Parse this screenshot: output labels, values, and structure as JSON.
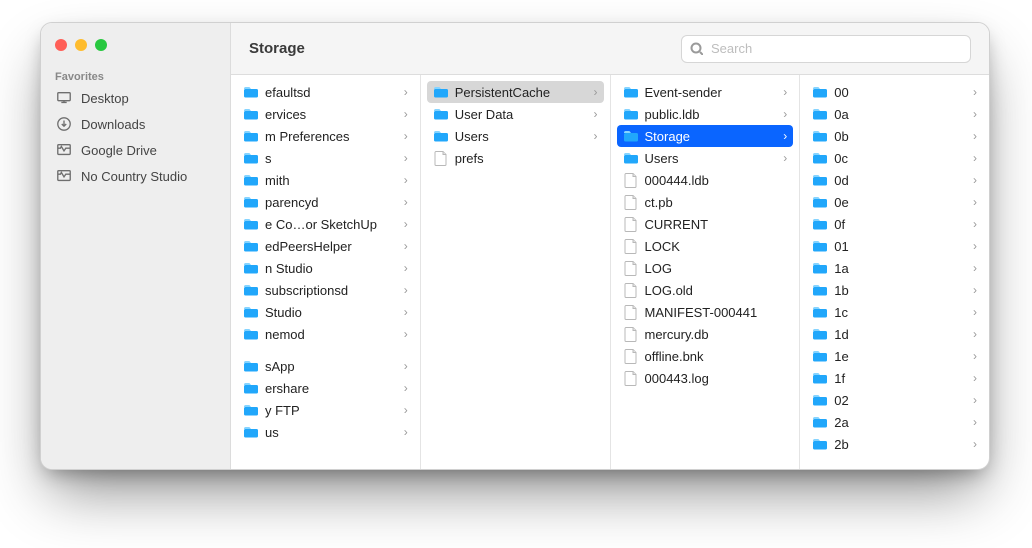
{
  "window": {
    "title": "Storage",
    "search_placeholder": "Search"
  },
  "sidebar": {
    "section_label": "Favorites",
    "items": [
      {
        "icon": "desktop",
        "label": "Desktop"
      },
      {
        "icon": "download",
        "label": "Downloads"
      },
      {
        "icon": "drive",
        "label": "Google Drive"
      },
      {
        "icon": "drive",
        "label": "No Country Studio"
      }
    ]
  },
  "columns": [
    {
      "items": [
        {
          "type": "folder",
          "label": "efaultsd"
        },
        {
          "type": "folder",
          "label": "ervices"
        },
        {
          "type": "folder",
          "label": "m Preferences"
        },
        {
          "type": "folder",
          "label": "s"
        },
        {
          "type": "folder",
          "label": "mith"
        },
        {
          "type": "folder",
          "label": "parencyd"
        },
        {
          "type": "folder",
          "label": "e Co…or SketchUp"
        },
        {
          "type": "folder",
          "label": "edPeersHelper"
        },
        {
          "type": "folder",
          "label": "n Studio"
        },
        {
          "type": "folder",
          "label": "subscriptionsd"
        },
        {
          "type": "folder",
          "label": "Studio"
        },
        {
          "type": "folder",
          "label": "nemod"
        },
        {
          "type": "gap"
        },
        {
          "type": "folder",
          "label": "sApp"
        },
        {
          "type": "folder",
          "label": "ershare"
        },
        {
          "type": "folder",
          "label": "y FTP"
        },
        {
          "type": "folder",
          "label": "us"
        }
      ]
    },
    {
      "items": [
        {
          "type": "folder",
          "label": "PersistentCache",
          "state": "path"
        },
        {
          "type": "folder",
          "label": "User Data"
        },
        {
          "type": "folder",
          "label": "Users"
        },
        {
          "type": "file",
          "label": "prefs"
        }
      ]
    },
    {
      "items": [
        {
          "type": "folder",
          "label": "Event-sender"
        },
        {
          "type": "folder",
          "label": "public.ldb"
        },
        {
          "type": "folder",
          "label": "Storage",
          "state": "selected"
        },
        {
          "type": "folder",
          "label": "Users"
        },
        {
          "type": "file",
          "label": "000444.ldb"
        },
        {
          "type": "file",
          "label": "ct.pb"
        },
        {
          "type": "file",
          "label": "CURRENT"
        },
        {
          "type": "file",
          "label": "LOCK"
        },
        {
          "type": "file",
          "label": "LOG"
        },
        {
          "type": "file",
          "label": "LOG.old"
        },
        {
          "type": "file",
          "label": "MANIFEST-000441"
        },
        {
          "type": "file",
          "label": "mercury.db"
        },
        {
          "type": "file",
          "label": "offline.bnk"
        },
        {
          "type": "file",
          "label": "000443.log"
        }
      ]
    },
    {
      "items": [
        {
          "type": "folder",
          "label": "00"
        },
        {
          "type": "folder",
          "label": "0a"
        },
        {
          "type": "folder",
          "label": "0b"
        },
        {
          "type": "folder",
          "label": "0c"
        },
        {
          "type": "folder",
          "label": "0d"
        },
        {
          "type": "folder",
          "label": "0e"
        },
        {
          "type": "folder",
          "label": "0f"
        },
        {
          "type": "folder",
          "label": "01"
        },
        {
          "type": "folder",
          "label": "1a"
        },
        {
          "type": "folder",
          "label": "1b"
        },
        {
          "type": "folder",
          "label": "1c"
        },
        {
          "type": "folder",
          "label": "1d"
        },
        {
          "type": "folder",
          "label": "1e"
        },
        {
          "type": "folder",
          "label": "1f"
        },
        {
          "type": "folder",
          "label": "02"
        },
        {
          "type": "folder",
          "label": "2a"
        },
        {
          "type": "folder",
          "label": "2b"
        }
      ]
    }
  ]
}
